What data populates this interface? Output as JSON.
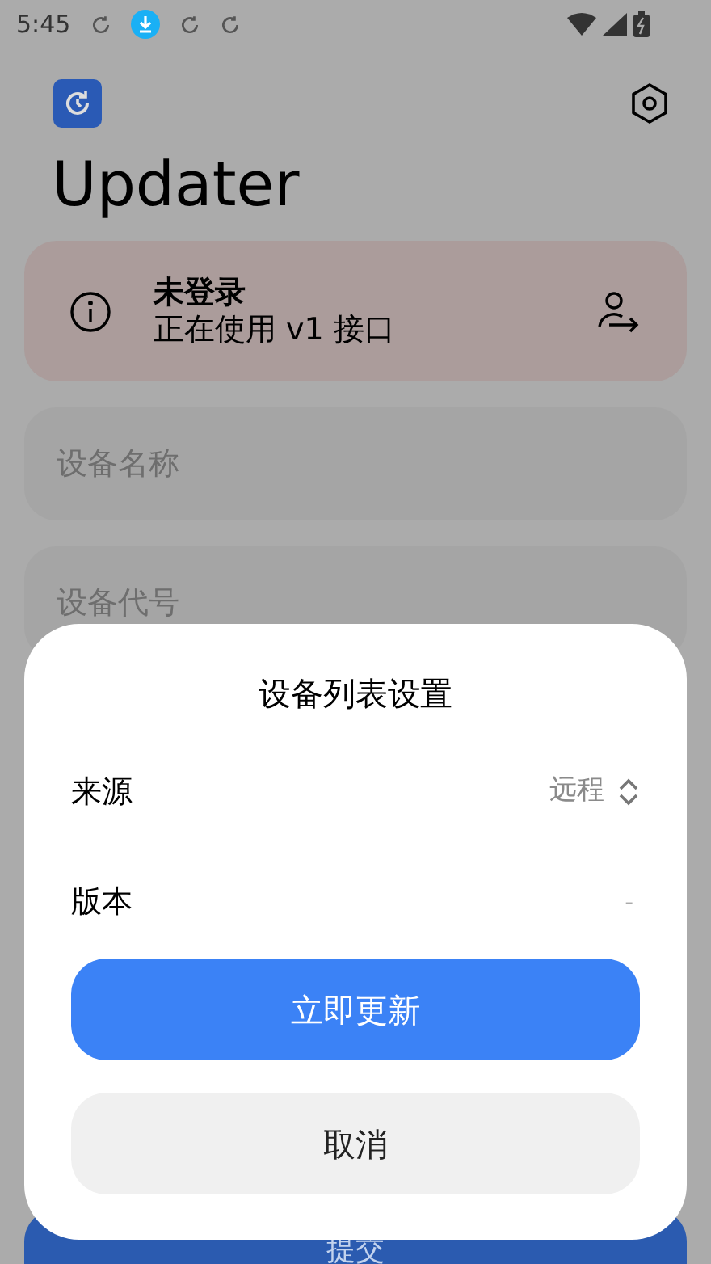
{
  "status_bar": {
    "time": "5:45"
  },
  "app": {
    "title": "Updater"
  },
  "login_card": {
    "title": "未登录",
    "subtitle": "正在使用 v1 接口"
  },
  "fields": [
    {
      "placeholder": "设备名称"
    },
    {
      "placeholder": "设备代号"
    }
  ],
  "submit_button": "提交",
  "dialog": {
    "title": "设备列表设置",
    "rows": [
      {
        "kind": "select",
        "label": "来源",
        "value": "远程"
      },
      {
        "kind": "text",
        "label": "版本",
        "value": "-"
      }
    ],
    "primary_button": "立即更新",
    "cancel_button": "取消"
  }
}
